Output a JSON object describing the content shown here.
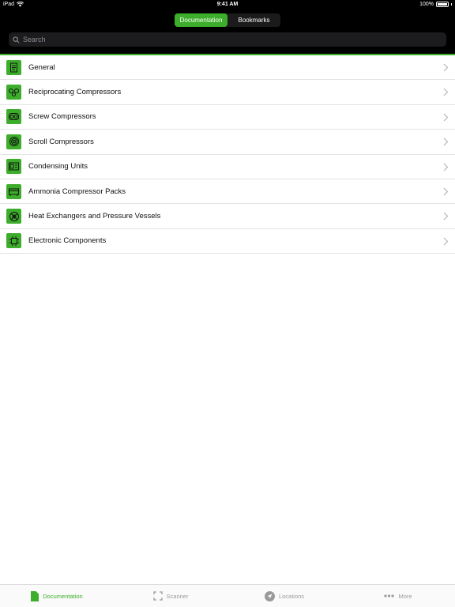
{
  "status": {
    "device": "iPad",
    "time": "9:41 AM",
    "battery": "100%"
  },
  "header": {
    "segments": [
      {
        "label": "Documentation",
        "active": true
      },
      {
        "label": "Bookmarks",
        "active": false
      }
    ],
    "search": {
      "placeholder": "Search",
      "value": ""
    }
  },
  "list": {
    "items": [
      {
        "label": "General",
        "icon": "document-icon"
      },
      {
        "label": "Reciprocating Compressors",
        "icon": "reciprocating-compressor-icon"
      },
      {
        "label": "Screw Compressors",
        "icon": "screw-compressor-icon"
      },
      {
        "label": "Scroll Compressors",
        "icon": "scroll-compressor-icon"
      },
      {
        "label": "Condensing Units",
        "icon": "condensing-unit-icon"
      },
      {
        "label": "Ammonia Compressor Packs",
        "icon": "compressor-pack-icon"
      },
      {
        "label": "Heat Exchangers and Pressure Vessels",
        "icon": "heat-exchanger-icon"
      },
      {
        "label": "Electronic Components",
        "icon": "electronic-component-icon"
      }
    ]
  },
  "tabbar": {
    "tabs": [
      {
        "label": "Documentation",
        "icon": "document-tab-icon",
        "active": true
      },
      {
        "label": "Scanner",
        "icon": "scanner-icon",
        "active": false
      },
      {
        "label": "Locations",
        "icon": "location-arrow-icon",
        "active": false
      },
      {
        "label": "More",
        "icon": "more-dots-icon",
        "active": false
      }
    ]
  },
  "colors": {
    "accent": "#3dae2b",
    "header_bg": "#000000"
  }
}
